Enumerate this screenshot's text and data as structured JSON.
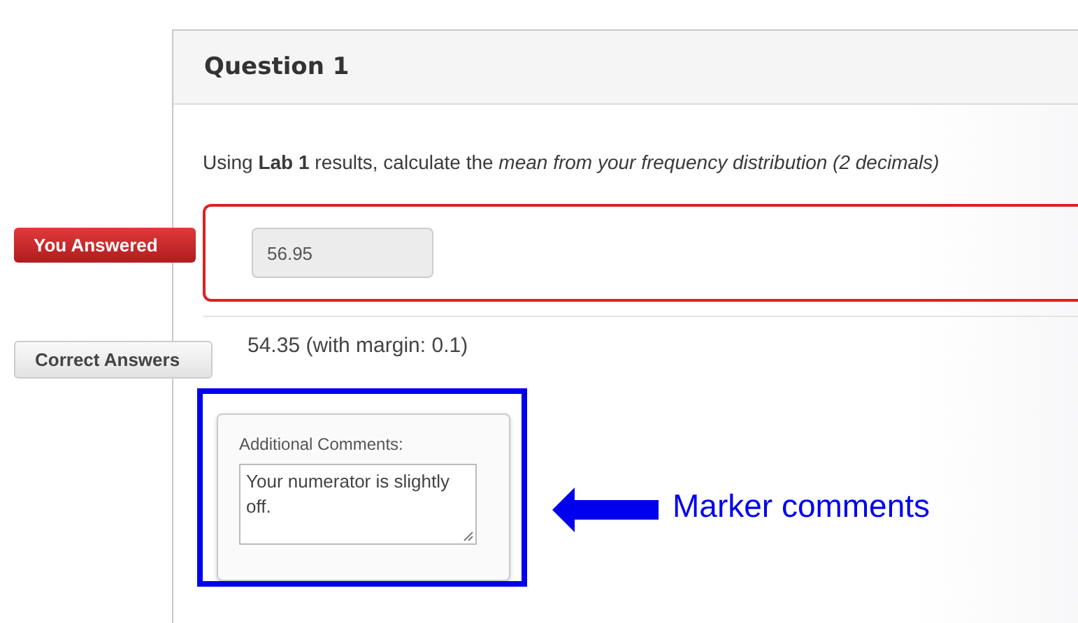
{
  "question": {
    "title": "Question 1",
    "text": "Using **Lab 1** results, calculate the *mean from your frequency distribution (2 decimals)*"
  },
  "your_answer": {
    "label": "You Answered",
    "value": "56.95",
    "correct": false
  },
  "correct_answers": {
    "label": "Correct Answers",
    "value": "54.35 (with margin: 0.1)"
  },
  "comments": {
    "label": "Additional Comments:",
    "value": "Your numerator is slightly off."
  },
  "annotation": {
    "text": "Marker comments"
  }
}
